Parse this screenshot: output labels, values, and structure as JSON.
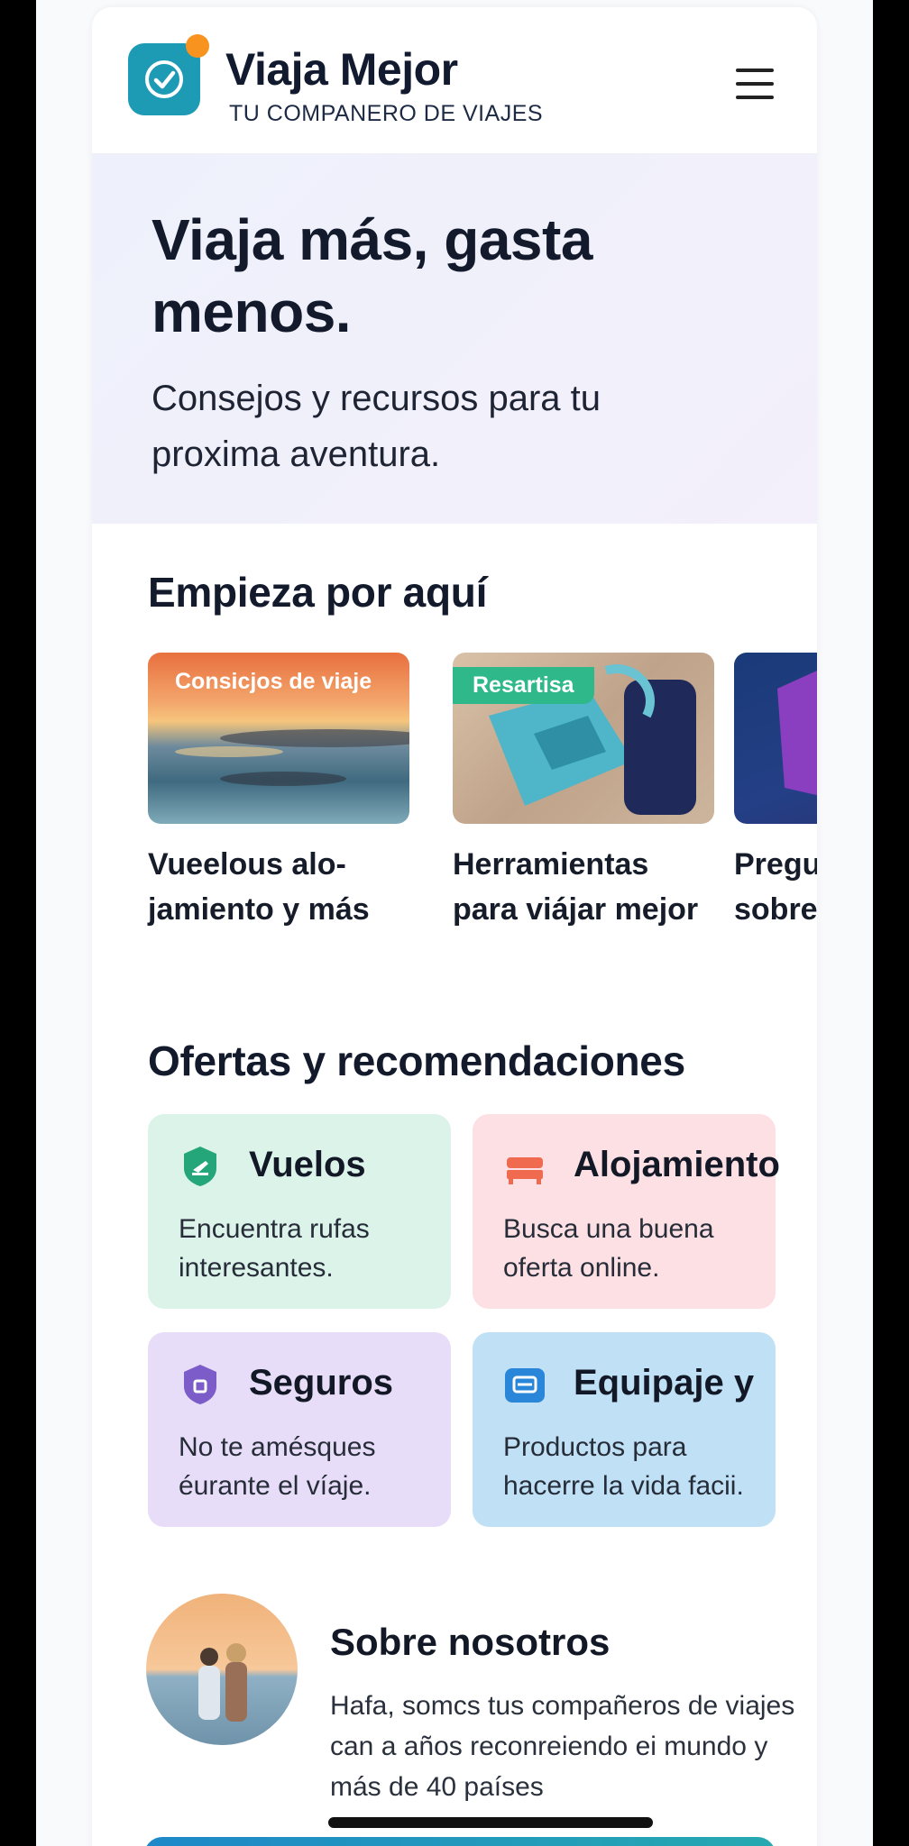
{
  "header": {
    "brand_name": "Viaja Mejor",
    "tagline": "TU COMPANERO DE VIAJES",
    "logo_icon": "check-circle-icon",
    "menu_icon": "hamburger-menu-icon"
  },
  "hero": {
    "title": "Viaja más, gasta menos.",
    "subtitle": "Consejos y recursos para tu proxima aventura."
  },
  "start_section": {
    "title": "Empieza por aquí",
    "cards": [
      {
        "tag": "Consicjos de viaje",
        "title": "Vueelous alo-jamiento y más",
        "tag_color": ""
      },
      {
        "tag": "Resartisa",
        "title": "Herramientas para viájar mejor",
        "tag_color": "#2fb889"
      },
      {
        "tag": "",
        "title": "Pregu frecu sobre",
        "tag_color": ""
      }
    ]
  },
  "offers_section": {
    "title": "Ofertas y recomendaciones",
    "items": [
      {
        "title": "Vuelos",
        "text": "Encuentra rufas interesantes.",
        "icon": "plane-badge-icon",
        "bg": "#dcf3ea",
        "icon_color": "#25a67a"
      },
      {
        "title": "Alojamiento",
        "text": "Busca una buena oferta online.",
        "icon": "bed-icon",
        "bg": "#fde0e3",
        "icon_color": "#f06a4f"
      },
      {
        "title": "Seguros",
        "text": "No te amésques éurante el víaje.",
        "icon": "shield-icon",
        "bg": "#e8ddf8",
        "icon_color": "#7b5cc8"
      },
      {
        "title": "Equipaje y",
        "text": "Productos para hacerre la vida facii.",
        "icon": "luggage-icon",
        "bg": "#bfe0f5",
        "icon_color": "#2a86d8"
      }
    ]
  },
  "about": {
    "title": "Sobre nosotros",
    "text": "Hafa, somcs tus compañeros de viajes can a años reconreiendo ei mundo y más de 40 países"
  }
}
